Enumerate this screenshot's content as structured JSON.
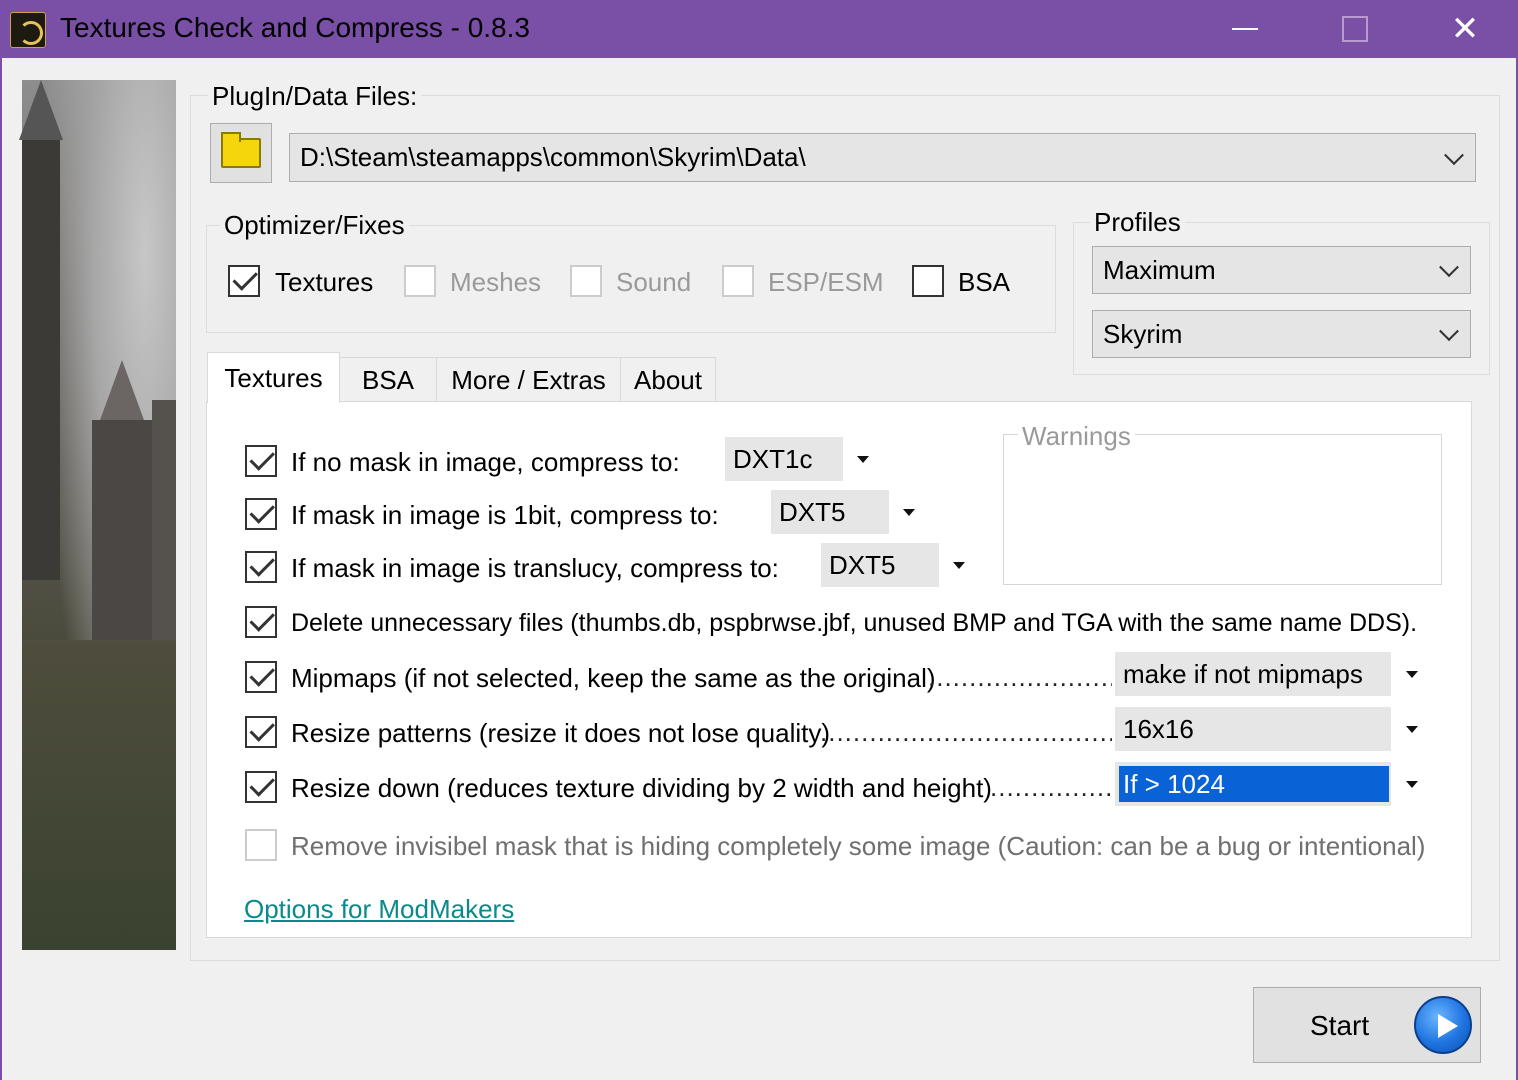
{
  "window": {
    "title": "Textures Check and Compress - 0.8.3",
    "close_glyph": "✕"
  },
  "plugin": {
    "label": "PlugIn/Data Files:",
    "path": "D:\\Steam\\steamapps\\common\\Skyrim\\Data\\"
  },
  "optimizer": {
    "title": "Optimizer/Fixes",
    "items": [
      {
        "label": "Textures",
        "checked": true,
        "enabled": true
      },
      {
        "label": "Meshes",
        "checked": false,
        "enabled": false
      },
      {
        "label": "Sound",
        "checked": false,
        "enabled": false
      },
      {
        "label": "ESP/ESM",
        "checked": false,
        "enabled": false
      },
      {
        "label": "BSA",
        "checked": false,
        "enabled": true
      }
    ]
  },
  "profiles": {
    "title": "Profiles",
    "profile": "Maximum",
    "game": "Skyrim"
  },
  "tabs": [
    {
      "label": "Textures",
      "active": true
    },
    {
      "label": "BSA",
      "active": false
    },
    {
      "label": "More / Extras",
      "active": false
    },
    {
      "label": "About",
      "active": false
    }
  ],
  "textures": {
    "no_mask": {
      "label": "If no mask in image, compress to:",
      "value": "DXT1c",
      "checked": true
    },
    "mask_1bit": {
      "label": "If mask in image is 1bit, compress to:",
      "value": "DXT5",
      "checked": true
    },
    "mask_translucent": {
      "label": "If mask in image is translucy, compress to:",
      "value": "DXT5",
      "checked": true
    },
    "delete_files": {
      "label": "Delete unnecessary files (thumbs.db, pspbrwse.jbf, unused BMP and TGA with the same name DDS).",
      "checked": true
    },
    "mipmaps": {
      "label": "Mipmaps (if not selected, keep the same as the original)",
      "value": "make if not mipmaps",
      "checked": true
    },
    "resize_patterns": {
      "label": "Resize patterns (resize it does not lose quality)",
      "value": "16x16",
      "checked": true
    },
    "resize_down": {
      "label": "Resize down (reduces texture dividing by 2 width and height)",
      "value": "If > 1024",
      "checked": true
    },
    "remove_mask": {
      "label": "Remove invisibel mask that is hiding completely some image (Caution: can be a bug or intentional)",
      "checked": false,
      "enabled": false
    },
    "warnings_title": "Warnings",
    "modmakers_link": "Options for ModMakers"
  },
  "start": {
    "label": "Start"
  }
}
